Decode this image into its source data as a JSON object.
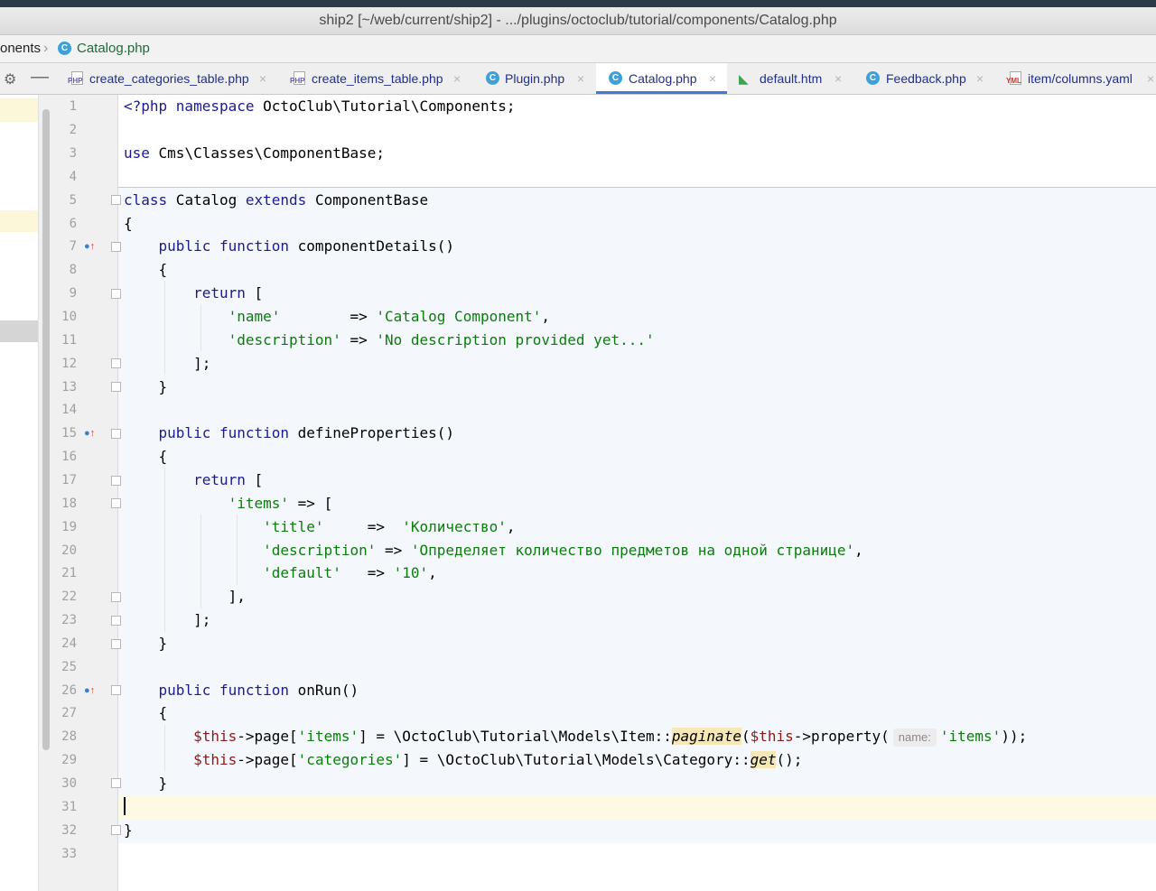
{
  "window": {
    "title": "ship2 [~/web/current/ship2] - .../plugins/octoclub/tutorial/components/Catalog.php"
  },
  "breadcrumb": {
    "parent": "onents",
    "separator": "›",
    "current": "Catalog.php"
  },
  "toolbar": {
    "settings_icon": "gear-icon",
    "collapse_icon": "minus-icon"
  },
  "tabs": [
    {
      "label": "create_categories_table.php",
      "icon": "php-file-icon",
      "active": false
    },
    {
      "label": "create_items_table.php",
      "icon": "php-file-icon",
      "active": false
    },
    {
      "label": "Plugin.php",
      "icon": "class-icon",
      "active": false
    },
    {
      "label": "Catalog.php",
      "icon": "class-icon",
      "active": true
    },
    {
      "label": "default.htm",
      "icon": "htm-file-icon",
      "active": false
    },
    {
      "label": "Feedback.php",
      "icon": "class-icon",
      "active": false
    },
    {
      "label": "item/columns.yaml",
      "icon": "yaml-file-icon",
      "active": false
    }
  ],
  "tab_close": "×",
  "icon_letters": {
    "class": "C",
    "php": "PHP",
    "yml": "YML"
  },
  "editor": {
    "line_numbers": [
      "1",
      "2",
      "3",
      "4",
      "5",
      "6",
      "7",
      "8",
      "9",
      "10",
      "11",
      "12",
      "13",
      "14",
      "15",
      "16",
      "17",
      "18",
      "19",
      "20",
      "21",
      "22",
      "23",
      "24",
      "25",
      "26",
      "27",
      "28",
      "29",
      "30",
      "31",
      "32",
      "33"
    ],
    "inlay_hint": "name:",
    "lines": {
      "l1_kw": "<?php namespace",
      "l1_rest": " OctoClub\\Tutorial\\Components;",
      "l3_kw": "use",
      "l3_rest": " Cms\\Classes\\ComponentBase;",
      "l5_kw1": "class",
      "l5_name": " Catalog ",
      "l5_kw2": "extends",
      "l5_rest": " ComponentBase",
      "open_brace": "{",
      "close_brace": "}",
      "public_function": "public function",
      "m1": " componentDetails()",
      "return": "return",
      "open_bracket": " [",
      "name_key": "'name'",
      "name_arrow": "        => ",
      "name_val": "'Catalog Component'",
      "comma": ",",
      "desc_key": "'description'",
      "desc_arrow": " => ",
      "desc_val": "'No description provided yet...'",
      "close_bracket_semi": "];",
      "m2": " defineProperties()",
      "items_key": "'items'",
      "items_arrow": " => [",
      "title_key": "'title'",
      "title_arrow": "     =>  ",
      "title_val": "'Количество'",
      "pdesc_key": "'description'",
      "pdesc_arrow": " => ",
      "pdesc_val": "'Определяет количество предметов на одной странице'",
      "default_key": "'default'",
      "default_arrow": "   => ",
      "default_val": "'10'",
      "close_bracket_comma": "],",
      "m3": " onRun()",
      "this": "$this",
      "page_access": "->page[",
      "items_str": "'items'",
      "l28_mid": "] = \\OctoClub\\Tutorial\\Models\\Item::",
      "paginate": "paginate",
      "l28_paren": "(",
      "property_call": "->property(",
      "l28_end": "));",
      "categories_str": "'categories'",
      "l29_mid": "] = \\OctoClub\\Tutorial\\Models\\Category::",
      "get": "get",
      "l29_end": "();"
    }
  }
}
